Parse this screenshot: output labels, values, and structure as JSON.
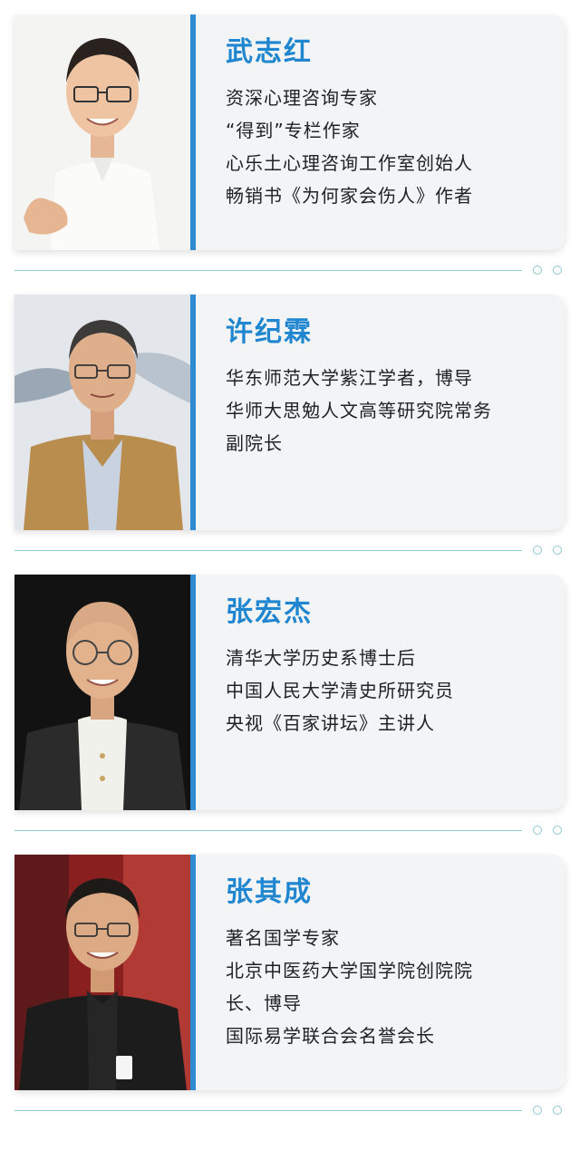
{
  "accent_color": "#1f86cf",
  "profiles": [
    {
      "name": "武志红",
      "lines": [
        "资深心理咨询专家",
        "“得到”专栏作家",
        "心乐土心理咨询工作室创始人",
        "畅销书《为何家会伤人》作者"
      ]
    },
    {
      "name": "许纪霖",
      "lines": [
        "华东师范大学紫江学者，博导",
        "华师大思勉人文高等研究院常务",
        "副院长"
      ]
    },
    {
      "name": "张宏杰",
      "lines": [
        "清华大学历史系博士后",
        "中国人民大学清史所研究员",
        "央视《百家讲坛》主讲人"
      ]
    },
    {
      "name": "张其成",
      "lines": [
        "著名国学专家",
        "北京中医药大学国学院创院院",
        "长、博导",
        "国际易学联合会名誉会长"
      ]
    }
  ]
}
